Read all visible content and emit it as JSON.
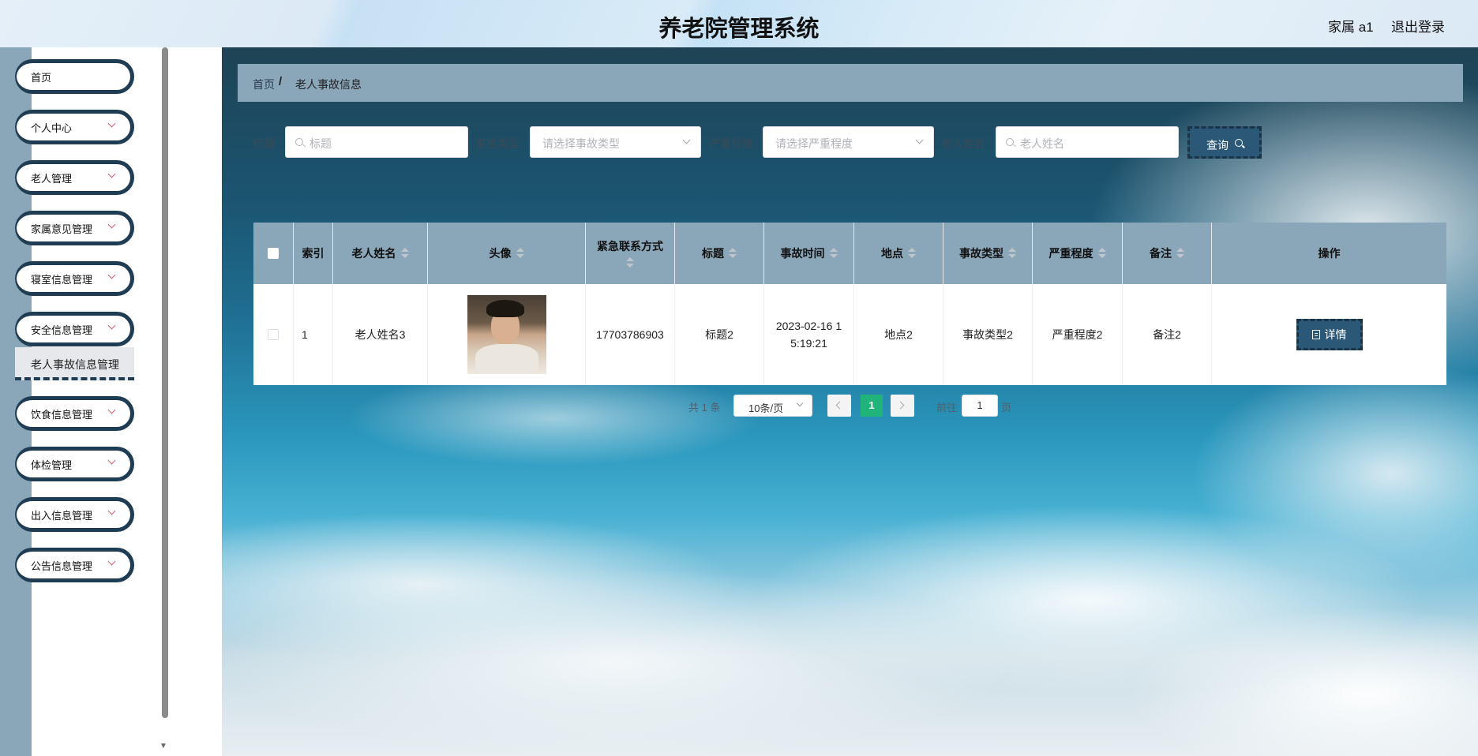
{
  "header": {
    "title": "养老院管理系统",
    "user": "家属 a1",
    "logout": "退出登录"
  },
  "sidebar": {
    "items": [
      {
        "label": "首页",
        "has_children": false
      },
      {
        "label": "个人中心",
        "has_children": true
      },
      {
        "label": "老人管理",
        "has_children": true
      },
      {
        "label": "家属意见管理",
        "has_children": true
      },
      {
        "label": "寝室信息管理",
        "has_children": true
      },
      {
        "label": "安全信息管理",
        "has_children": true,
        "expanded": true
      },
      {
        "label": "饮食信息管理",
        "has_children": true
      },
      {
        "label": "体检管理",
        "has_children": true
      },
      {
        "label": "出入信息管理",
        "has_children": true
      },
      {
        "label": "公告信息管理",
        "has_children": true
      }
    ],
    "active_subitem": "老人事故信息管理"
  },
  "breadcrumb": {
    "home": "首页",
    "separator": "/",
    "current": "老人事故信息"
  },
  "filters": {
    "title": {
      "label": "标题",
      "placeholder": "标题"
    },
    "type": {
      "label": "事故类型",
      "placeholder": "请选择事故类型"
    },
    "severity": {
      "label": "严重程度",
      "placeholder": "请选择严重程度"
    },
    "name": {
      "label": "老人姓名",
      "placeholder": "老人姓名"
    },
    "search_label": "查询"
  },
  "table": {
    "columns": [
      "索引",
      "老人姓名",
      "头像",
      "紧急联系方式",
      "标题",
      "事故时间",
      "地点",
      "事故类型",
      "严重程度",
      "备注",
      "操作"
    ],
    "rows": [
      {
        "index": "1",
        "name": "老人姓名3",
        "phone": "17703786903",
        "title": "标题2",
        "time": "2023-02-16 15:19:21",
        "location": "地点2",
        "type": "事故类型2",
        "severity": "严重程度2",
        "remark": "备注2",
        "action": "详情"
      }
    ]
  },
  "pagination": {
    "total": "共 1 条",
    "page_size": "10条/页",
    "current_page": "1",
    "goto_label": "前往",
    "goto_value": "1",
    "goto_suffix": "页"
  },
  "colors": {
    "accent": "#2c5878",
    "nav_border": "#1f3c55",
    "header_row": "#8aa6b9",
    "active_page": "#20b37a"
  }
}
